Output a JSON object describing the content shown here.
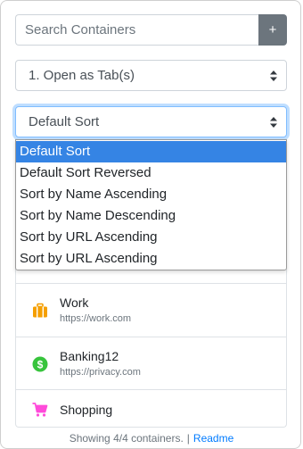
{
  "search": {
    "placeholder": "Search Containers",
    "add_label": "+"
  },
  "open_mode": {
    "selected": "1. Open as Tab(s)"
  },
  "sort": {
    "selected": "Default Sort",
    "options": [
      "Default Sort",
      "Default Sort Reversed",
      "Sort by Name Ascending",
      "Sort by Name Descending",
      "Sort by URL Ascending",
      "Sort by URL Ascending"
    ],
    "highlighted_index": 0
  },
  "containers": [
    {
      "name": "Work",
      "url": "https://work.com",
      "icon": "briefcase-icon",
      "color": "#f59f00"
    },
    {
      "name": "Banking12",
      "url": "https://privacy.com",
      "icon": "dollar-icon",
      "color": "#37c43c"
    },
    {
      "name": "Shopping",
      "url": "",
      "icon": "cart-icon",
      "color": "#ff4bda"
    }
  ],
  "footer": {
    "status": "Showing 4/4 containers.",
    "separator": "|",
    "link": "Readme"
  }
}
